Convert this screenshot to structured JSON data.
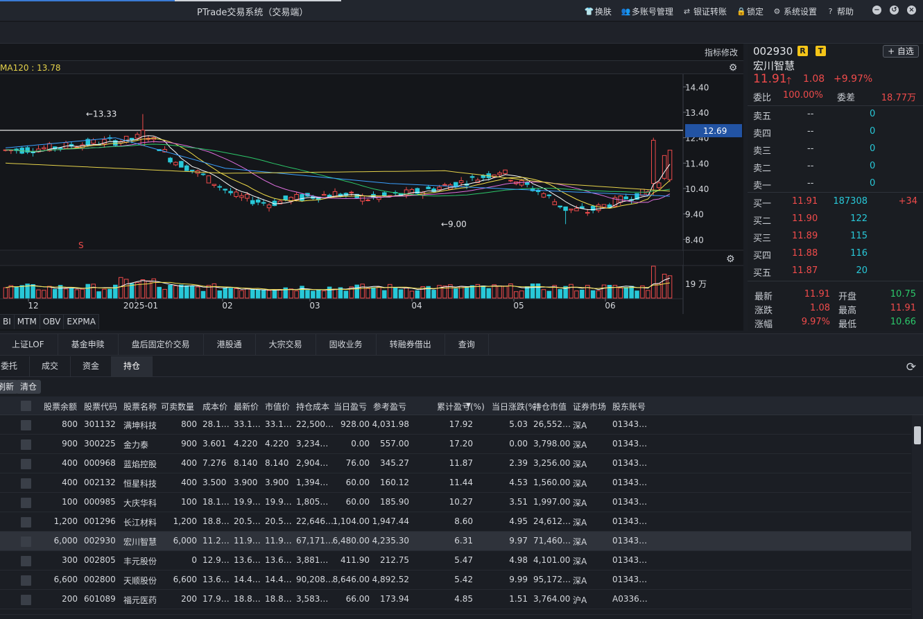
{
  "title": "PTrade交易系统（交易端）",
  "menu": [
    {
      "icon": "shirt-icon",
      "glyph": "👕",
      "label": "换肤"
    },
    {
      "icon": "users-icon",
      "glyph": "👥",
      "label": "多账号管理"
    },
    {
      "icon": "transfer-icon",
      "glyph": "⇄",
      "label": "银证转账"
    },
    {
      "icon": "lock-icon",
      "glyph": "🔒",
      "label": "锁定"
    },
    {
      "icon": "gear-icon",
      "glyph": "⚙",
      "label": "系统设置"
    },
    {
      "icon": "help-icon",
      "glyph": "?",
      "label": "帮助"
    }
  ],
  "chart": {
    "indicator_edit": "指标修改",
    "ma_text": "MA120 : 13.78",
    "price_ticks": [
      "14.40",
      "13.40",
      "12.40",
      "11.40",
      "10.40",
      "9.40",
      "8.40"
    ],
    "high_label": "←13.33",
    "low_label": "←9.00",
    "sell_mark": "S",
    "current_line": "12.69",
    "volume_label": "19 万",
    "x_labels": [
      "12",
      "2025-01",
      "02",
      "03",
      "04",
      "05",
      "06"
    ],
    "indicator_tabs": [
      "BI",
      "MTM",
      "OBV",
      "EXPMA"
    ],
    "colors": {
      "up": "#f04b4b",
      "down": "#28c8d8",
      "ma5": "#ffffff",
      "ma10": "#f5e04a",
      "ma20": "#e070e0",
      "ma60": "#2cc86a",
      "ma120": "#3aa0ff",
      "ma250": "#e5d24a"
    }
  },
  "quote": {
    "code": "002930",
    "badge_r": "R",
    "badge_t": "T",
    "add_btn": "+ 自选",
    "name": "宏川智慧",
    "price": "11.91",
    "arrow": "🡑",
    "change": "1.08",
    "pct": "+9.97%",
    "webi_label": "委比",
    "webi": "100.00%",
    "wecha_label": "委差",
    "wecha": "18.77万",
    "sells": [
      {
        "label": "卖五",
        "price": "--",
        "vol": "0"
      },
      {
        "label": "卖四",
        "price": "--",
        "vol": "0"
      },
      {
        "label": "卖三",
        "price": "--",
        "vol": "0"
      },
      {
        "label": "卖二",
        "price": "--",
        "vol": "0"
      },
      {
        "label": "卖一",
        "price": "--",
        "vol": "0"
      }
    ],
    "buys": [
      {
        "label": "买一",
        "price": "11.91",
        "vol": "187308",
        "delta": "+34"
      },
      {
        "label": "买二",
        "price": "11.90",
        "vol": "122",
        "delta": ""
      },
      {
        "label": "买三",
        "price": "11.89",
        "vol": "115",
        "delta": ""
      },
      {
        "label": "买四",
        "price": "11.88",
        "vol": "116",
        "delta": ""
      },
      {
        "label": "买五",
        "price": "11.87",
        "vol": "20",
        "delta": ""
      }
    ],
    "stats": [
      {
        "l1": "最新",
        "v1": "11.91",
        "c1": "red",
        "l2": "开盘",
        "v2": "10.75",
        "c2": "green"
      },
      {
        "l1": "涨跌",
        "v1": "1.08",
        "c1": "red",
        "l2": "最高",
        "v2": "11.91",
        "c2": "red"
      },
      {
        "l1": "涨幅",
        "v1": "9.97%",
        "c1": "red",
        "l2": "最低",
        "v2": "10.66",
        "c2": "green"
      }
    ]
  },
  "func_tabs": [
    "上证LOF",
    "基金申赎",
    "盘后固定价交易",
    "港股通",
    "大宗交易",
    "固收业务",
    "转融券借出",
    "查询"
  ],
  "sub_tabs": [
    "委托",
    "成交",
    "资金",
    "持仓"
  ],
  "actions": {
    "refresh_btn": "刷新",
    "clear_btn": "清仓"
  },
  "table": {
    "headers": [
      "股票余额",
      "股票代码",
      "股票名称",
      "可卖数量",
      "成本价",
      "最新价",
      "市值价",
      "持仓成本",
      "当日盈亏",
      "参考盈亏",
      "累计盈亏(%)",
      "当日涨跌(%)",
      "持仓市值",
      "证券市场",
      "股东账号"
    ],
    "sort_arrow": "▼",
    "rows": [
      [
        "800",
        "301132",
        "满坤科技",
        "800",
        "28.1…",
        "33.1…",
        "33.1…",
        "22,500…",
        "928.00",
        "4,031.98",
        "17.92",
        "5.03",
        "26,552…",
        "深A",
        "01343…"
      ],
      [
        "900",
        "300225",
        "金力泰",
        "900",
        "3.601",
        "4.220",
        "4.220",
        "3,234…",
        "0.00",
        "557.00",
        "17.20",
        "0.00",
        "3,798.00",
        "深A",
        "01343…"
      ],
      [
        "400",
        "000968",
        "蓝焰控股",
        "400",
        "7.276",
        "8.140",
        "8.140",
        "2,904…",
        "76.00",
        "345.27",
        "11.87",
        "2.39",
        "3,256.00",
        "深A",
        "01343…"
      ],
      [
        "400",
        "002132",
        "恒星科技",
        "400",
        "3.500",
        "3.900",
        "3.900",
        "1,394…",
        "60.00",
        "160.12",
        "11.44",
        "4.53",
        "1,560.00",
        "深A",
        "01343…"
      ],
      [
        "100",
        "000985",
        "大庆华科",
        "100",
        "18.1…",
        "19.9…",
        "19.9…",
        "1,805…",
        "60.00",
        "185.90",
        "10.27",
        "3.51",
        "1,997.00",
        "深A",
        "01343…"
      ],
      [
        "1,200",
        "001296",
        "长江材料",
        "1,200",
        "18.8…",
        "20.5…",
        "20.5…",
        "22,646…",
        "1,104.00",
        "1,947.44",
        "8.60",
        "4.95",
        "24,612…",
        "深A",
        "01343…"
      ],
      [
        "6,000",
        "002930",
        "宏川智慧",
        "6,000",
        "11.2…",
        "11.9…",
        "11.9…",
        "67,171…",
        "6,480.00",
        "4,235.30",
        "6.31",
        "9.97",
        "71,460…",
        "深A",
        "01343…"
      ],
      [
        "300",
        "002805",
        "丰元股份",
        "0",
        "12.9…",
        "13.6…",
        "13.6…",
        "3,881…",
        "411.90",
        "212.75",
        "5.47",
        "4.98",
        "4,101.00",
        "深A",
        "01343…"
      ],
      [
        "6,600",
        "002800",
        "天顺股份",
        "6,600",
        "13.6…",
        "14.4…",
        "14.4…",
        "90,208…",
        "8,646.00",
        "4,892.52",
        "5.42",
        "9.99",
        "95,172…",
        "深A",
        "01343…"
      ],
      [
        "200",
        "601089",
        "福元医药",
        "200",
        "17.9…",
        "18.8…",
        "18.8…",
        "3,583…",
        "66.00",
        "173.94",
        "4.85",
        "1.51",
        "3,764.00",
        "沪A",
        "A0336…"
      ]
    ]
  }
}
